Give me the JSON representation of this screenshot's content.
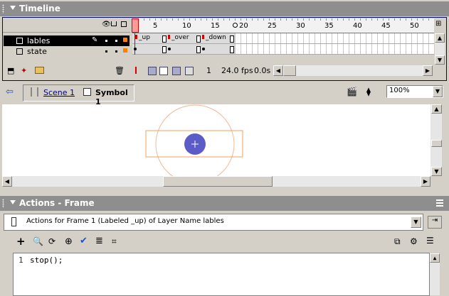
{
  "timeline": {
    "title": "Timeline",
    "layers": [
      {
        "name": "lables",
        "selected": true
      },
      {
        "name": "state",
        "selected": false
      }
    ],
    "ruler_numbers": [
      "5",
      "10",
      "15",
      "20",
      "25",
      "30",
      "35",
      "40",
      "45",
      "50"
    ],
    "frame_labels": [
      "_up",
      "_over",
      "_down"
    ],
    "current_frame": "1",
    "frame_rate": "24.0 fps",
    "elapsed_time": "0.0s",
    "colors": {
      "selected_row": "#000000",
      "playhead": "#d60000",
      "layer_outline": "#ff8000"
    },
    "icons": [
      "eye-icon",
      "lock-icon",
      "outline-icon",
      "pencil-icon",
      "add-layer-icon",
      "add-guide-layer-icon",
      "insert-folder-icon",
      "trash-icon",
      "center-frame-icon",
      "onion-skin-icon",
      "onion-skin-outlines-icon",
      "edit-multiple-frames-icon",
      "modify-onion-markers-icon"
    ]
  },
  "edit_bar": {
    "back_arrow": "back-arrow-icon",
    "scene": "Scene 1",
    "symbol": "Symbol 1",
    "zoom": "100%"
  },
  "actions": {
    "title": "Actions - Frame",
    "description": "Actions for Frame 1 (Labeled _up)  of Layer Name lables",
    "line_number": "1",
    "code": "stop();",
    "icons": [
      "add-statement-icon",
      "find-icon",
      "replace-icon",
      "insert-target-path-icon",
      "check-syntax-icon",
      "auto-format-icon",
      "code-hint-icon",
      "reference-icon",
      "view-options-icon",
      "pin-icon"
    ]
  },
  "stage": {
    "colors": {
      "button_fill": "#5c5cc8",
      "outline": "#f0a060",
      "circle": "#f2b898"
    }
  }
}
